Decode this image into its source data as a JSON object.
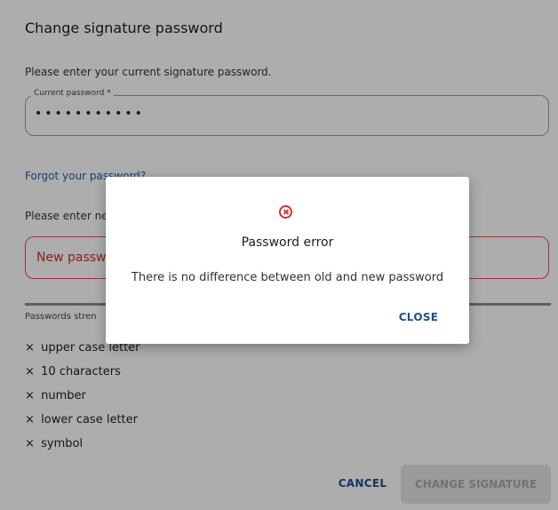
{
  "page": {
    "title": "Change signature password",
    "current_hint": "Please enter your current signature password.",
    "current_field": {
      "label": "Current password *",
      "value": "•••••••••••"
    },
    "forgot_link": "Forgot your password?",
    "new_hint": "Please enter new",
    "new_field": {
      "placeholder": "New passwo"
    },
    "strength_label": "Passwords stren",
    "requirements": [
      {
        "mark": "×",
        "text": "upper case letter"
      },
      {
        "mark": "×",
        "text": "10 characters"
      },
      {
        "mark": "×",
        "text": "number"
      },
      {
        "mark": "×",
        "text": "lower case letter"
      },
      {
        "mark": "×",
        "text": "symbol"
      }
    ],
    "cancel_label": "CANCEL",
    "change_label": "CHANGE SIGNATURE"
  },
  "dialog": {
    "icon": "error-circle-x-icon",
    "title": "Password error",
    "message": "There is no difference between old and new password",
    "close_label": "CLOSE"
  },
  "colors": {
    "accent": "#1f4f8f",
    "link": "#1f5fa8",
    "error": "#d03035",
    "disabled_bg": "#e3e3e3",
    "overlay": "rgba(0,0,0,0.32)"
  }
}
